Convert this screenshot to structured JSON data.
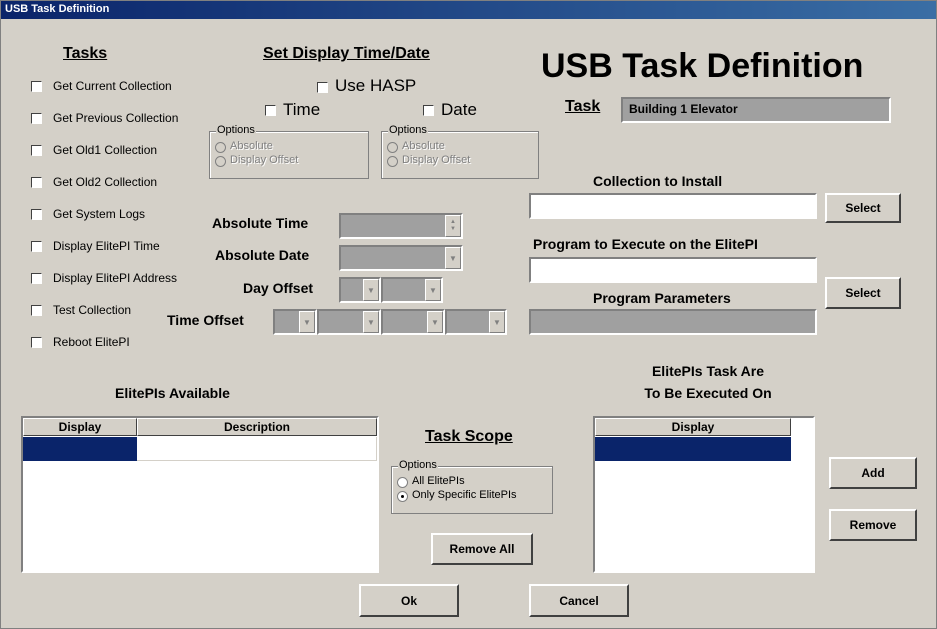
{
  "window": {
    "title": "USB Task Definition"
  },
  "heading": "USB Task Definition",
  "tasks": {
    "title": "Tasks",
    "items": [
      {
        "label": "Get Current Collection"
      },
      {
        "label": "Get Previous Collection"
      },
      {
        "label": "Get Old1 Collection"
      },
      {
        "label": "Get Old2 Collection"
      },
      {
        "label": "Get System Logs"
      },
      {
        "label": "Display ElitePI Time"
      },
      {
        "label": "Display ElitePI Address"
      },
      {
        "label": "Test Collection"
      },
      {
        "label": "Reboot ElitePI"
      }
    ]
  },
  "display_time": {
    "title": "Set Display Time/Date",
    "use_hasp": "Use HASP",
    "time_label": "Time",
    "date_label": "Date",
    "options_label": "Options",
    "absolute": "Absolute",
    "display_offset": "Display Offset",
    "absolute_time": "Absolute Time",
    "absolute_date": "Absolute Date",
    "day_offset": "Day Offset",
    "time_offset": "Time Offset"
  },
  "task": {
    "label": "Task",
    "value": "Building 1 Elevator"
  },
  "collection": {
    "label": "Collection to Install",
    "value": "",
    "select": "Select"
  },
  "program": {
    "label": "Program to Execute on the ElitePI",
    "value": ""
  },
  "params": {
    "label": "Program Parameters",
    "select": "Select"
  },
  "available": {
    "title": "ElitePIs Available",
    "columns": [
      "Display",
      "Description"
    ]
  },
  "scope": {
    "title": "Task Scope",
    "options_label": "Options",
    "all": "All ElitePIs",
    "specific": "Only Specific ElitePIs",
    "selected": "specific",
    "remove_all": "Remove All"
  },
  "executed": {
    "title_line1": "ElitePIs Task Are",
    "title_line2": "To Be Executed On",
    "columns": [
      "Display"
    ],
    "add": "Add",
    "remove": "Remove"
  },
  "footer": {
    "ok": "Ok",
    "cancel": "Cancel"
  },
  "colors": {
    "title_bar": "#0a246a",
    "face": "#d4d0c8",
    "selection": "#0a246a"
  }
}
